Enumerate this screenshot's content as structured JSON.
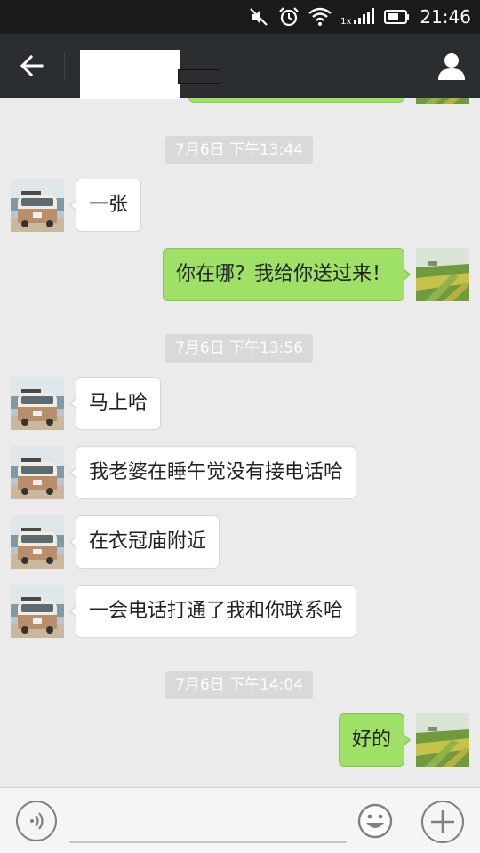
{
  "status_bar": {
    "time": "21:46",
    "network_label": "1x",
    "icons": [
      "mute-icon",
      "alarm-icon",
      "wifi-icon",
      "signal-icon",
      "battery-icon"
    ]
  },
  "header": {
    "contact_name": "",
    "icons": [
      "back-arrow-icon",
      "person-icon"
    ]
  },
  "timestamps": [
    "7月6日 下午13:44",
    "7月6日 下午13:56",
    "7月6日 下午14:04"
  ],
  "messages": [
    {
      "from": "contact",
      "text": "一张"
    },
    {
      "from": "me",
      "text": "你在哪？我给你送过来！"
    },
    {
      "from": "contact",
      "text": "马上哈"
    },
    {
      "from": "contact",
      "text": "我老婆在睡午觉没有接电话哈"
    },
    {
      "from": "contact",
      "text": "在衣冠庙附近"
    },
    {
      "from": "contact",
      "text": "一会电话打通了我和你联系哈"
    },
    {
      "from": "me",
      "text": "好的"
    }
  ],
  "input_bar": {
    "value": "",
    "placeholder": "",
    "icons": [
      "voice-icon",
      "emoji-icon",
      "plus-icon"
    ]
  },
  "colors": {
    "header_bg": "#2a2e30",
    "chat_bg": "#ebebeb",
    "outgoing_bubble": "#9fe067",
    "incoming_bubble": "#ffffff",
    "timestamp_bg": "#d9d9d9"
  }
}
